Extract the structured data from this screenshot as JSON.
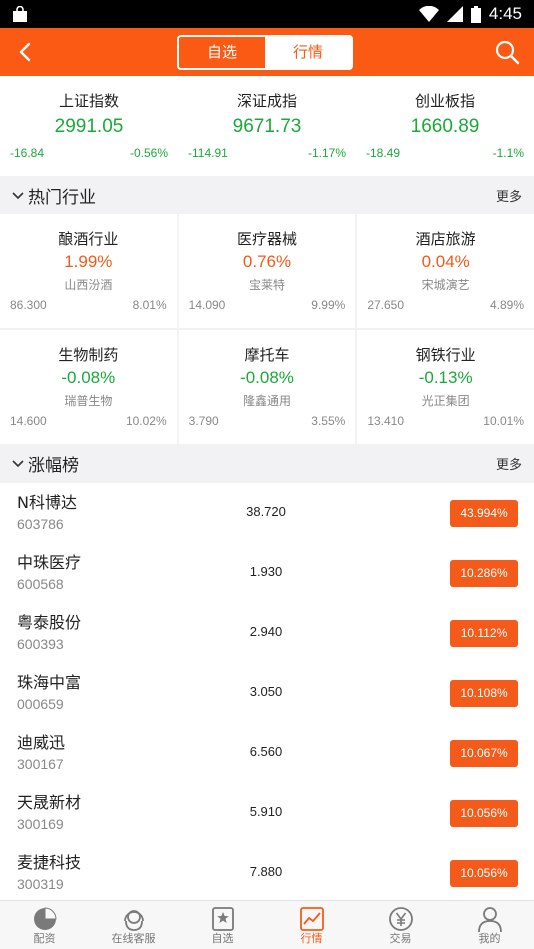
{
  "status_bar": {
    "time": "4:45"
  },
  "header": {
    "segments": [
      {
        "label": "自选",
        "active": false
      },
      {
        "label": "行情",
        "active": true
      }
    ],
    "accent_color": "#fb5a14"
  },
  "indices": [
    {
      "name": "上证指数",
      "value": "2991.05",
      "change": "-16.84",
      "pct": "-0.56%"
    },
    {
      "name": "深证成指",
      "value": "9671.73",
      "change": "-114.91",
      "pct": "-1.17%"
    },
    {
      "name": "创业板指",
      "value": "1660.89",
      "change": "-18.49",
      "pct": "-1.1%"
    }
  ],
  "hot_industries": {
    "title": "热门行业",
    "more": "更多",
    "items": [
      {
        "name": "酿酒行业",
        "pct": "1.99%",
        "leader": "山西汾酒",
        "price": "86.300",
        "leader_pct": "8.01%",
        "dir": "up"
      },
      {
        "name": "医疗器械",
        "pct": "0.76%",
        "leader": "宝莱特",
        "price": "14.090",
        "leader_pct": "9.99%",
        "dir": "up"
      },
      {
        "name": "酒店旅游",
        "pct": "0.04%",
        "leader": "宋城演艺",
        "price": "27.650",
        "leader_pct": "4.89%",
        "dir": "up"
      },
      {
        "name": "生物制药",
        "pct": "-0.08%",
        "leader": "瑞普生物",
        "price": "14.600",
        "leader_pct": "10.02%",
        "dir": "down"
      },
      {
        "name": "摩托车",
        "pct": "-0.08%",
        "leader": "隆鑫通用",
        "price": "3.790",
        "leader_pct": "3.55%",
        "dir": "down"
      },
      {
        "name": "钢铁行业",
        "pct": "-0.13%",
        "leader": "光正集团",
        "price": "13.410",
        "leader_pct": "10.01%",
        "dir": "down"
      }
    ]
  },
  "gainers": {
    "title": "涨幅榜",
    "more": "更多",
    "rows": [
      {
        "name": "N科博达",
        "code": "603786",
        "price": "38.720",
        "pct": "43.994%"
      },
      {
        "name": "中珠医疗",
        "code": "600568",
        "price": "1.930",
        "pct": "10.286%"
      },
      {
        "name": "粤泰股份",
        "code": "600393",
        "price": "2.940",
        "pct": "10.112%"
      },
      {
        "name": "珠海中富",
        "code": "000659",
        "price": "3.050",
        "pct": "10.108%"
      },
      {
        "name": "迪威迅",
        "code": "300167",
        "price": "6.560",
        "pct": "10.067%"
      },
      {
        "name": "天晟新材",
        "code": "300169",
        "price": "5.910",
        "pct": "10.056%"
      },
      {
        "name": "麦捷科技",
        "code": "300319",
        "price": "7.880",
        "pct": "10.056%"
      }
    ]
  },
  "tabbar": [
    {
      "label": "配资",
      "icon": "pie-chart-icon"
    },
    {
      "label": "在线客服",
      "icon": "headset-icon"
    },
    {
      "label": "自选",
      "icon": "bookmark-star-icon"
    },
    {
      "label": "行情",
      "icon": "trend-chart-icon",
      "active": true
    },
    {
      "label": "交易",
      "icon": "yen-coin-icon"
    },
    {
      "label": "我的",
      "icon": "user-icon"
    }
  ]
}
